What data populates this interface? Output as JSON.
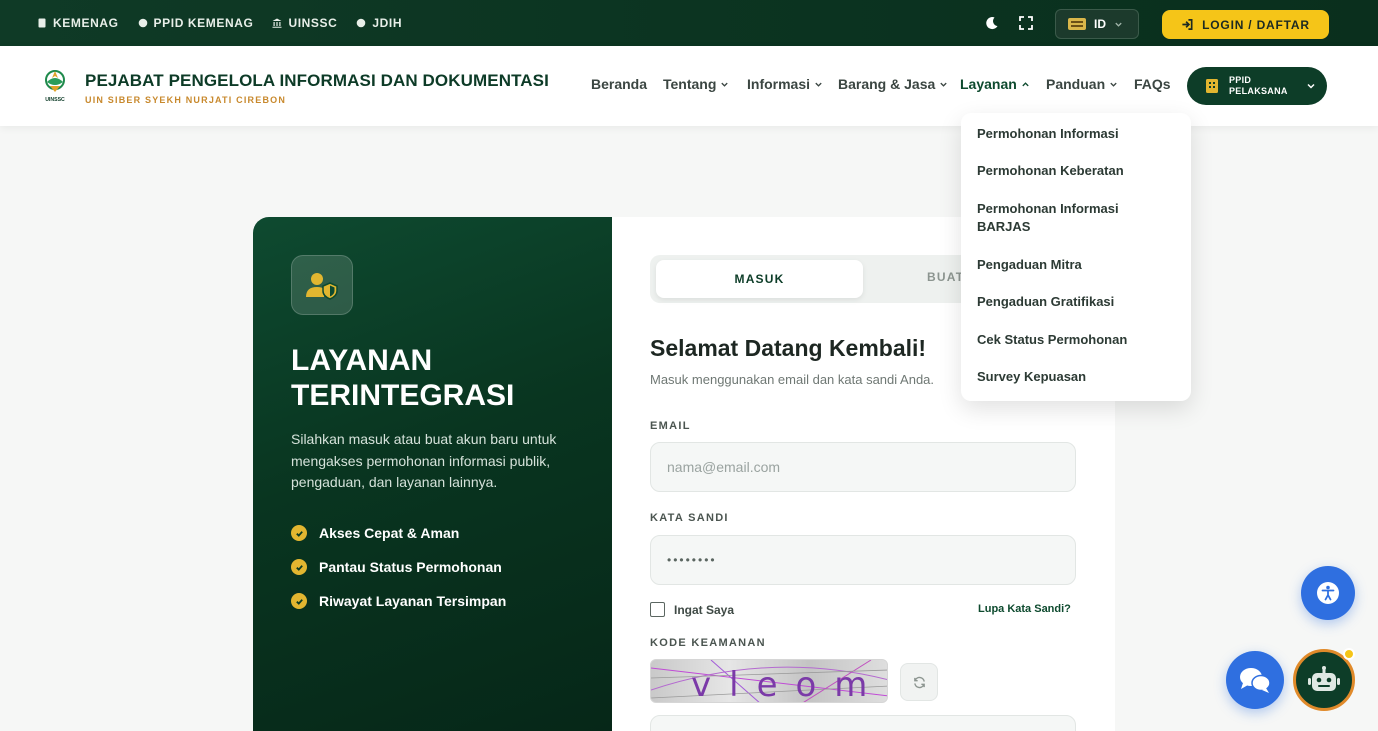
{
  "topbar": {
    "links": [
      {
        "label": "KEMENAG",
        "icon": "building-icon"
      },
      {
        "label": "PPID KEMENAG",
        "icon": "globe-icon"
      },
      {
        "label": "UINSSC",
        "icon": "bank-icon"
      },
      {
        "label": "JDIH",
        "icon": "globe-icon"
      }
    ],
    "language": "ID",
    "login_label": "LOGIN / DAFTAR"
  },
  "header": {
    "logo_text": "UINSSC",
    "title": "PEJABAT PENGELOLA INFORMASI DAN DOKUMENTASI",
    "subtitle": "UIN SIBER SYEKH NURJATI CIREBON",
    "nav": [
      "Beranda",
      "Tentang",
      "Informasi",
      "Barang & Jasa",
      "Layanan",
      "Panduan",
      "FAQs"
    ],
    "ppid_button": {
      "line1": "PPID",
      "line2": "PELAKSANA"
    }
  },
  "dropdown": {
    "items": [
      "Permohonan Informasi",
      "Permohonan Keberatan",
      "Permohonan Informasi BARJAS",
      "Pengaduan Mitra",
      "Pengaduan Gratifikasi",
      "Cek Status Permohonan",
      "Survey Kepuasan"
    ]
  },
  "left_panel": {
    "title_line1": "LAYANAN",
    "title_line2": "TERINTEGRASI",
    "description": "Silahkan masuk atau buat akun baru untuk mengakses permohonan informasi publik, pengaduan, dan layanan lainnya.",
    "features": [
      "Akses Cepat & Aman",
      "Pantau Status Permohonan",
      "Riwayat Layanan Tersimpan"
    ]
  },
  "form": {
    "tab_login": "MASUK",
    "tab_register": "BUAT AKUN",
    "welcome": "Selamat Datang Kembali!",
    "welcome_sub": "Masuk menggunakan email dan kata sandi Anda.",
    "email_label": "EMAIL",
    "email_placeholder": "nama@email.com",
    "password_label": "KATA SANDI",
    "password_value": "••••••••",
    "remember_label": "Ingat Saya",
    "forgot_label": "Lupa Kata Sandi?",
    "captcha_label": "KODE KEAMANAN",
    "captcha_text": "vleom"
  },
  "colors": {
    "primary": "#0d3d28",
    "accent": "#f5c518",
    "gold": "#e2b630",
    "accessibility": "#2f6fe0"
  }
}
